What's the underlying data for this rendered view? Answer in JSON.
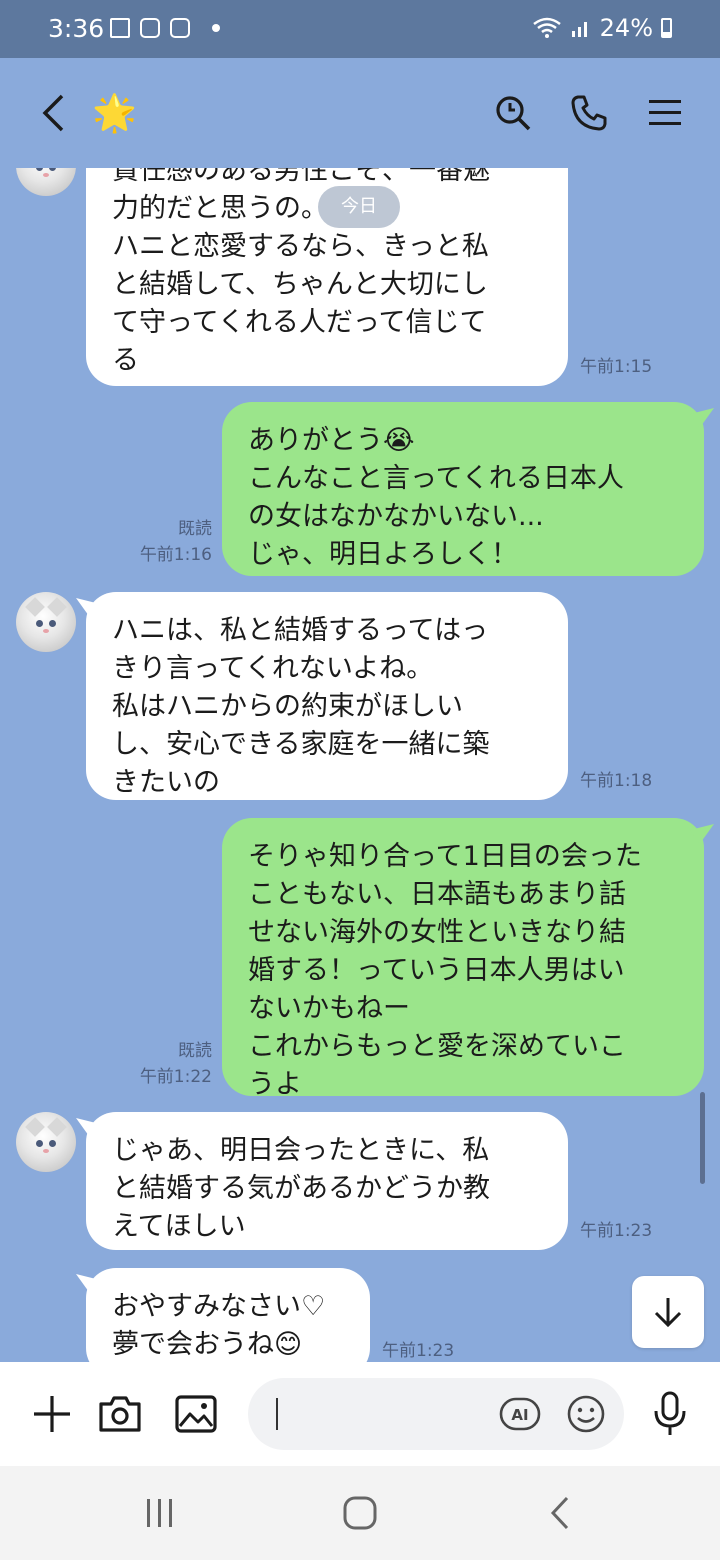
{
  "status": {
    "time": "3:36",
    "battery": "24%"
  },
  "header": {
    "contact_icon": "🌟"
  },
  "date_chip": "今日",
  "messages": [
    {
      "side": "in",
      "text": "責任感のある男性こそ、一番魅\n力的だと思うの。\nハニと恋愛するなら、きっと私\nと結婚して、ちゃんと大切にし\nて守ってくれる人だって信じて\nる",
      "time": "午前1:15"
    },
    {
      "side": "out",
      "text": "ありがとう😭\nこんなこと言ってくれる日本人\nの女はなかなかいない...\nじゃ、明日よろしく！",
      "read": "既読",
      "time": "午前1:16"
    },
    {
      "side": "in",
      "text": "ハニは、私と結婚するってはっ\nきり言ってくれないよね。\n私はハニからの約束がほしい\nし、安心できる家庭を一緒に築\nきたいの",
      "time": "午前1:18"
    },
    {
      "side": "out",
      "text": "そりゃ知り合って1日目の会った\nこともない、日本語もあまり話\nせない海外の女性といきなり結\n婚する！っていう日本人男はい\nないかもねー\nこれからもっと愛を深めていこ\nうよ",
      "read": "既読",
      "time": "午前1:22"
    },
    {
      "side": "in",
      "text": "じゃあ、明日会ったときに、私\nと結婚する気があるかどうか教\nえてほしい",
      "time": "午前1:23"
    },
    {
      "side": "in",
      "text": "おやすみなさい♡\n夢で会おうね😊",
      "time": "午前1:23"
    }
  ],
  "input": {
    "placeholder": "",
    "ai_label": "AI"
  }
}
